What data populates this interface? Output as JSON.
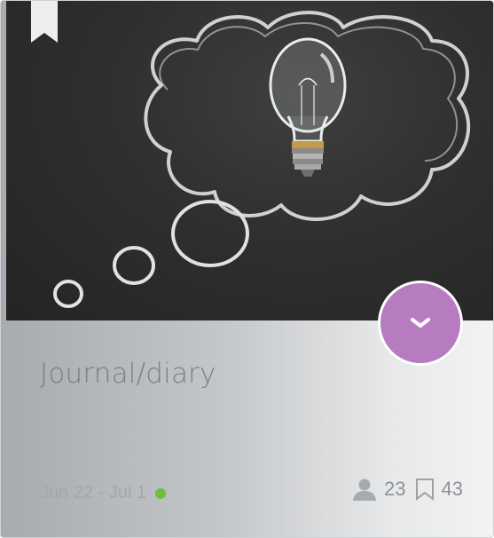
{
  "card": {
    "title": "Journal/diary",
    "date_range": "Jun 22 - Jul 1",
    "status_color": "#6cbf3b",
    "accent_color": "#b77cc0",
    "members_count": "23",
    "bookmarks_count": "43",
    "image": "chalkboard thought-bubble with light bulb",
    "icons": {
      "bookmark_ribbon": "bookmark-ribbon-icon",
      "expand": "chevron-down-icon",
      "members": "person-icon",
      "bookmarks": "bookmark-icon"
    }
  }
}
